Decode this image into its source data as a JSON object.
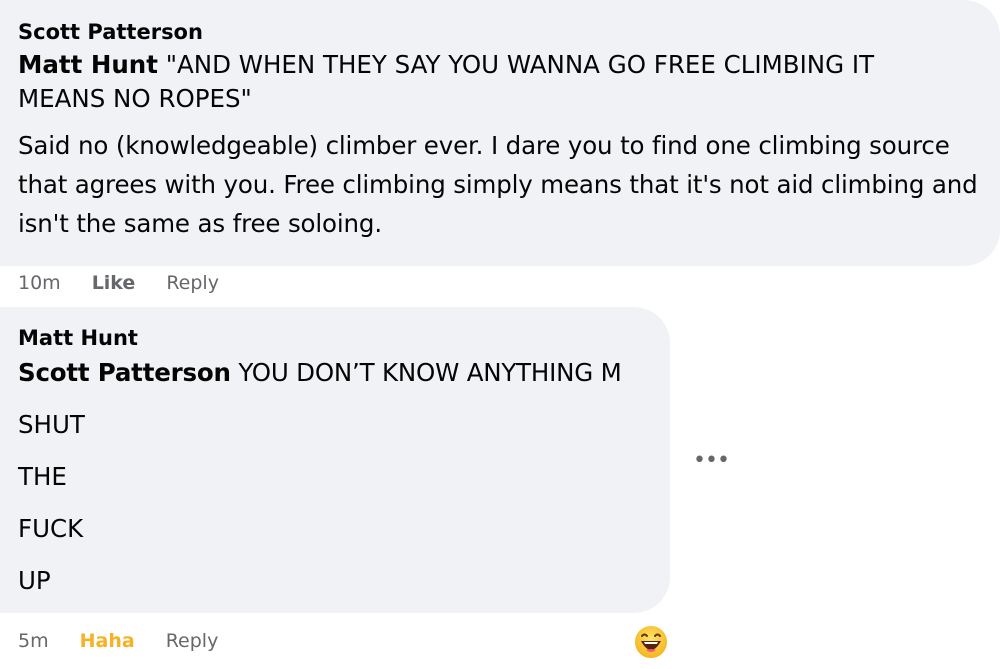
{
  "comments": [
    {
      "author": "Scott Patterson",
      "reply_mention": "Matt Hunt",
      "quote": " \"AND WHEN THEY SAY YOU WANNA GO FREE CLIMBING IT MEANS NO ROPES\"",
      "body": "Said no (knowledgeable) climber ever. I dare you to find one climbing source that agrees with you. Free climbing simply means that it's not aid climbing and isn't the same as free soloing.",
      "actions": {
        "time": "10m",
        "like": "Like",
        "reply": "Reply"
      }
    },
    {
      "author": "Matt Hunt",
      "reply_mention": "Scott Patterson",
      "first_line": " YOU DON’T KNOW ANYTHING M",
      "lines": [
        "SHUT",
        "THE",
        "FUCK",
        "UP"
      ],
      "actions": {
        "time": "5m",
        "reaction_label": "Haha",
        "reply": "Reply"
      },
      "reaction_icon": "grinning-face-icon"
    }
  ],
  "more_options_icon": "ellipsis-icon",
  "colors": {
    "bubble": "#f0f2f5",
    "meta_text": "#65676b",
    "haha": "#f7b125"
  }
}
